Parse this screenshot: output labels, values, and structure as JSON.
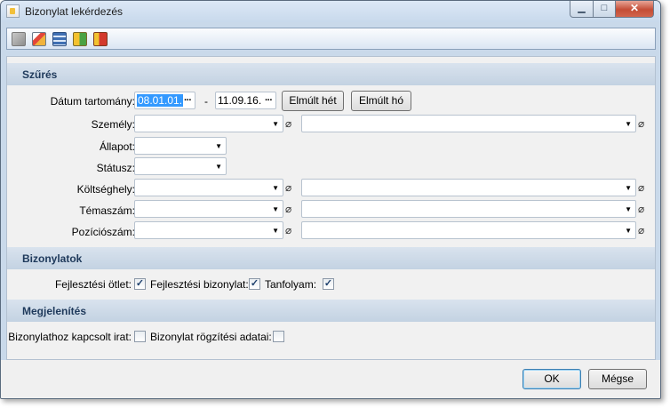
{
  "window": {
    "title": "Bizonylat lekérdezés",
    "minimize_symbol": "▁",
    "maximize_symbol": "□",
    "close_symbol": "✕"
  },
  "toolbar": {
    "icons": [
      "copy-icon",
      "edit-icon",
      "calculator-icon",
      "export-icon",
      "exit-icon"
    ]
  },
  "filter": {
    "header": "Szűrés",
    "date_range_label": "Dátum tartomány:",
    "date_from": "08.01.01.",
    "date_separator": "-",
    "date_to": "11.09.16.",
    "last_week_button": "Elmúlt hét",
    "last_month_button": "Elmúlt hó",
    "person_label": "Személy:",
    "state_label": "Állapot:",
    "status_label": "Státusz:",
    "cost_center_label": "Költséghely:",
    "topic_number_label": "Témaszám:",
    "position_number_label": "Pozíciószám:"
  },
  "documents": {
    "header": "Bizonylatok",
    "dev_idea_label": "Fejlesztési ötlet:",
    "dev_idea_checked": true,
    "dev_doc_label": "Fejlesztési bizonylat:",
    "dev_doc_checked": true,
    "course_label": "Tanfolyam:",
    "course_checked": true
  },
  "display": {
    "header": "Megjelenítés",
    "attached_label": "Bizonylathoz kapcsolt irat:",
    "attached_checked": false,
    "record_data_label": "Bizonylat rögzítési adatai:",
    "record_data_checked": false
  },
  "footer": {
    "ok_label": "OK",
    "cancel_label": "Mégse"
  },
  "glyphs": {
    "dropdown": "▼",
    "paperclip": "⌀",
    "check": "✓",
    "ellipsis": "···"
  }
}
